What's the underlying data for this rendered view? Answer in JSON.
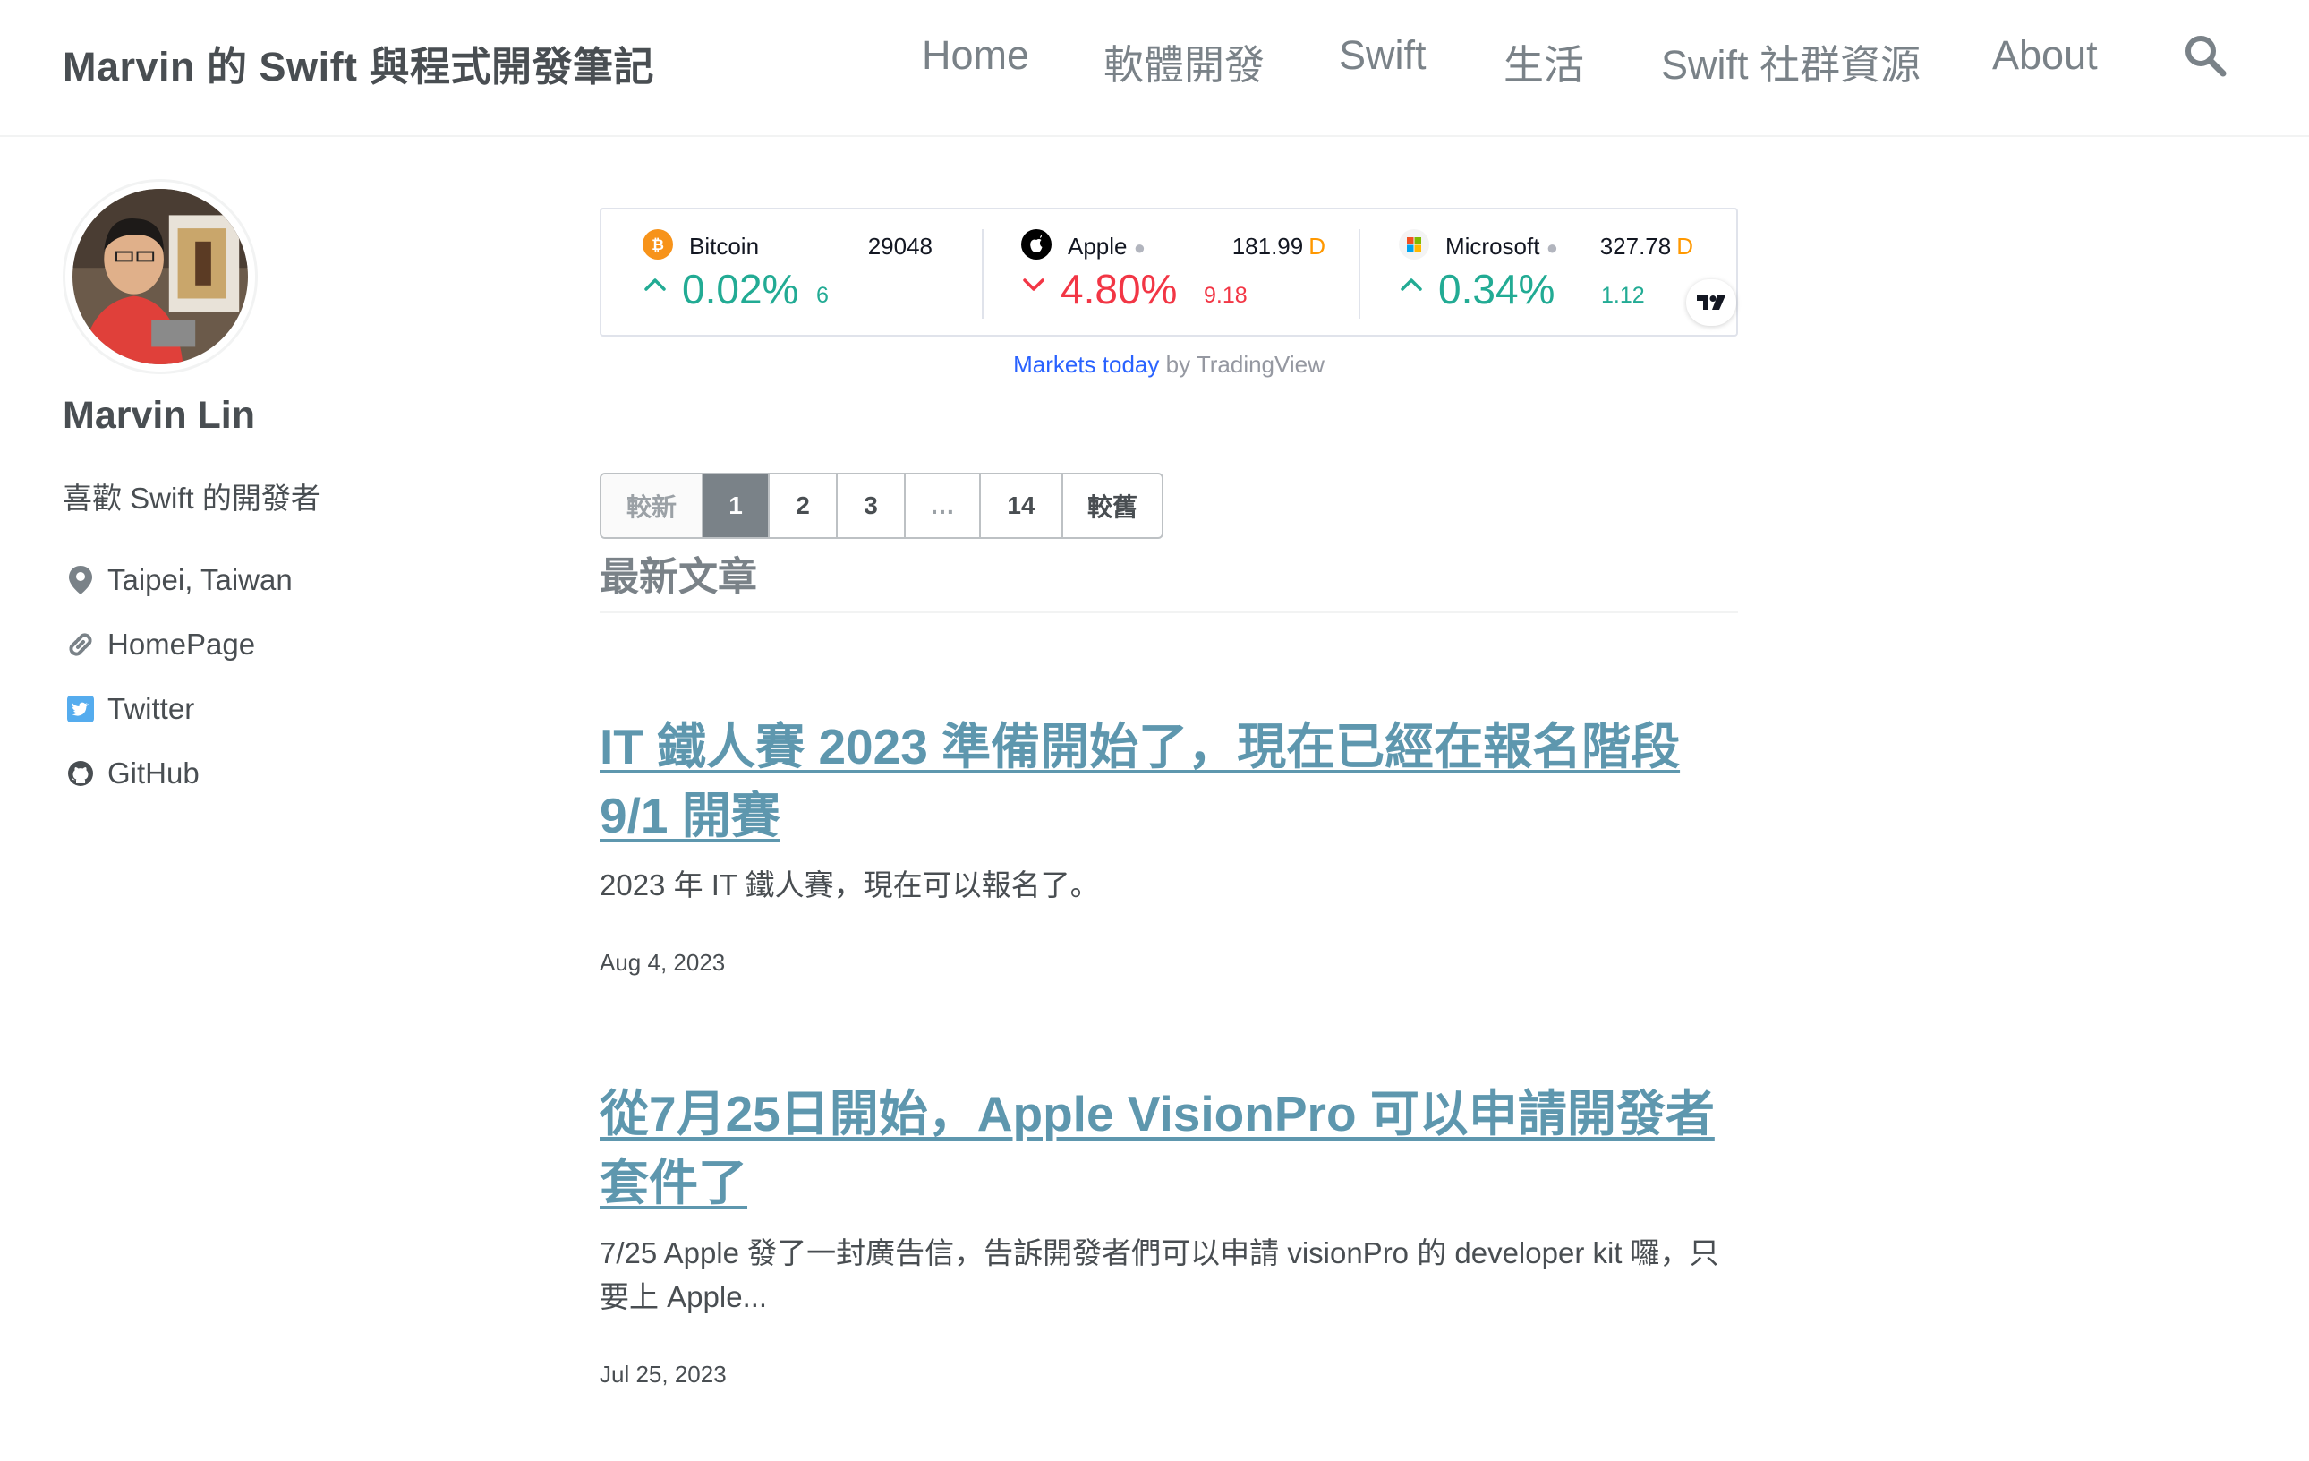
{
  "site": {
    "title": "Marvin 的 Swift 與程式開發筆記"
  },
  "nav": {
    "items": [
      {
        "label": "Home"
      },
      {
        "label": "軟體開發"
      },
      {
        "label": "Swift"
      },
      {
        "label": "生活"
      },
      {
        "label": "Swift 社群資源"
      },
      {
        "label": "About"
      }
    ],
    "search_icon": "search-icon"
  },
  "author": {
    "name": "Marvin Lin",
    "bio": "喜歡 Swift 的開發者",
    "links": [
      {
        "icon": "location-pin-icon",
        "label": "Taipei, Taiwan"
      },
      {
        "icon": "link-icon",
        "label": "HomePage"
      },
      {
        "icon": "twitter-icon",
        "label": "Twitter"
      },
      {
        "icon": "github-icon",
        "label": "GitHub"
      }
    ]
  },
  "ticker": {
    "items": [
      {
        "name": "Bitcoin",
        "price": "29048",
        "price_suffix": "",
        "change_pct": "0.02%",
        "change_abs": "6",
        "direction": "up",
        "icon": "bitcoin-icon",
        "color": "#f7931a"
      },
      {
        "name": "Apple",
        "price": "181.99",
        "price_suffix": "D",
        "change_pct": "4.80%",
        "change_abs": "9.18",
        "direction": "down",
        "icon": "apple-icon",
        "color": "#000000"
      },
      {
        "name": "Microsoft",
        "price": "327.78",
        "price_suffix": "D",
        "change_pct": "0.34%",
        "change_abs": "1.12",
        "direction": "up",
        "icon": "microsoft-icon",
        "color": "#f25022"
      }
    ],
    "caption_link": "Markets today",
    "caption_rest": " by TradingView"
  },
  "pagination": {
    "prev": "較新",
    "pages": [
      "1",
      "2",
      "3",
      "…",
      "14"
    ],
    "next": "較舊",
    "current": "1"
  },
  "section_title": "最新文章",
  "posts": [
    {
      "title": "IT 鐵人賽 2023 準備開始了，現在已經在報名階段 9/1 開賽",
      "excerpt": "2023 年 IT 鐵人賽，現在可以報名了。",
      "date": "Aug 4, 2023"
    },
    {
      "title": "從7月25日開始，Apple VisionPro 可以申請開發者套件了",
      "excerpt": "7/25 Apple 發了一封廣告信，告訴開發者們可以申請 visionPro 的 developer kit 囉，只要上 Apple...",
      "date": "Jul 25, 2023"
    }
  ],
  "colors": {
    "link": "#5e97ae",
    "up": "#22ab94",
    "down": "#f23645",
    "accent_d": "#ff9800"
  }
}
